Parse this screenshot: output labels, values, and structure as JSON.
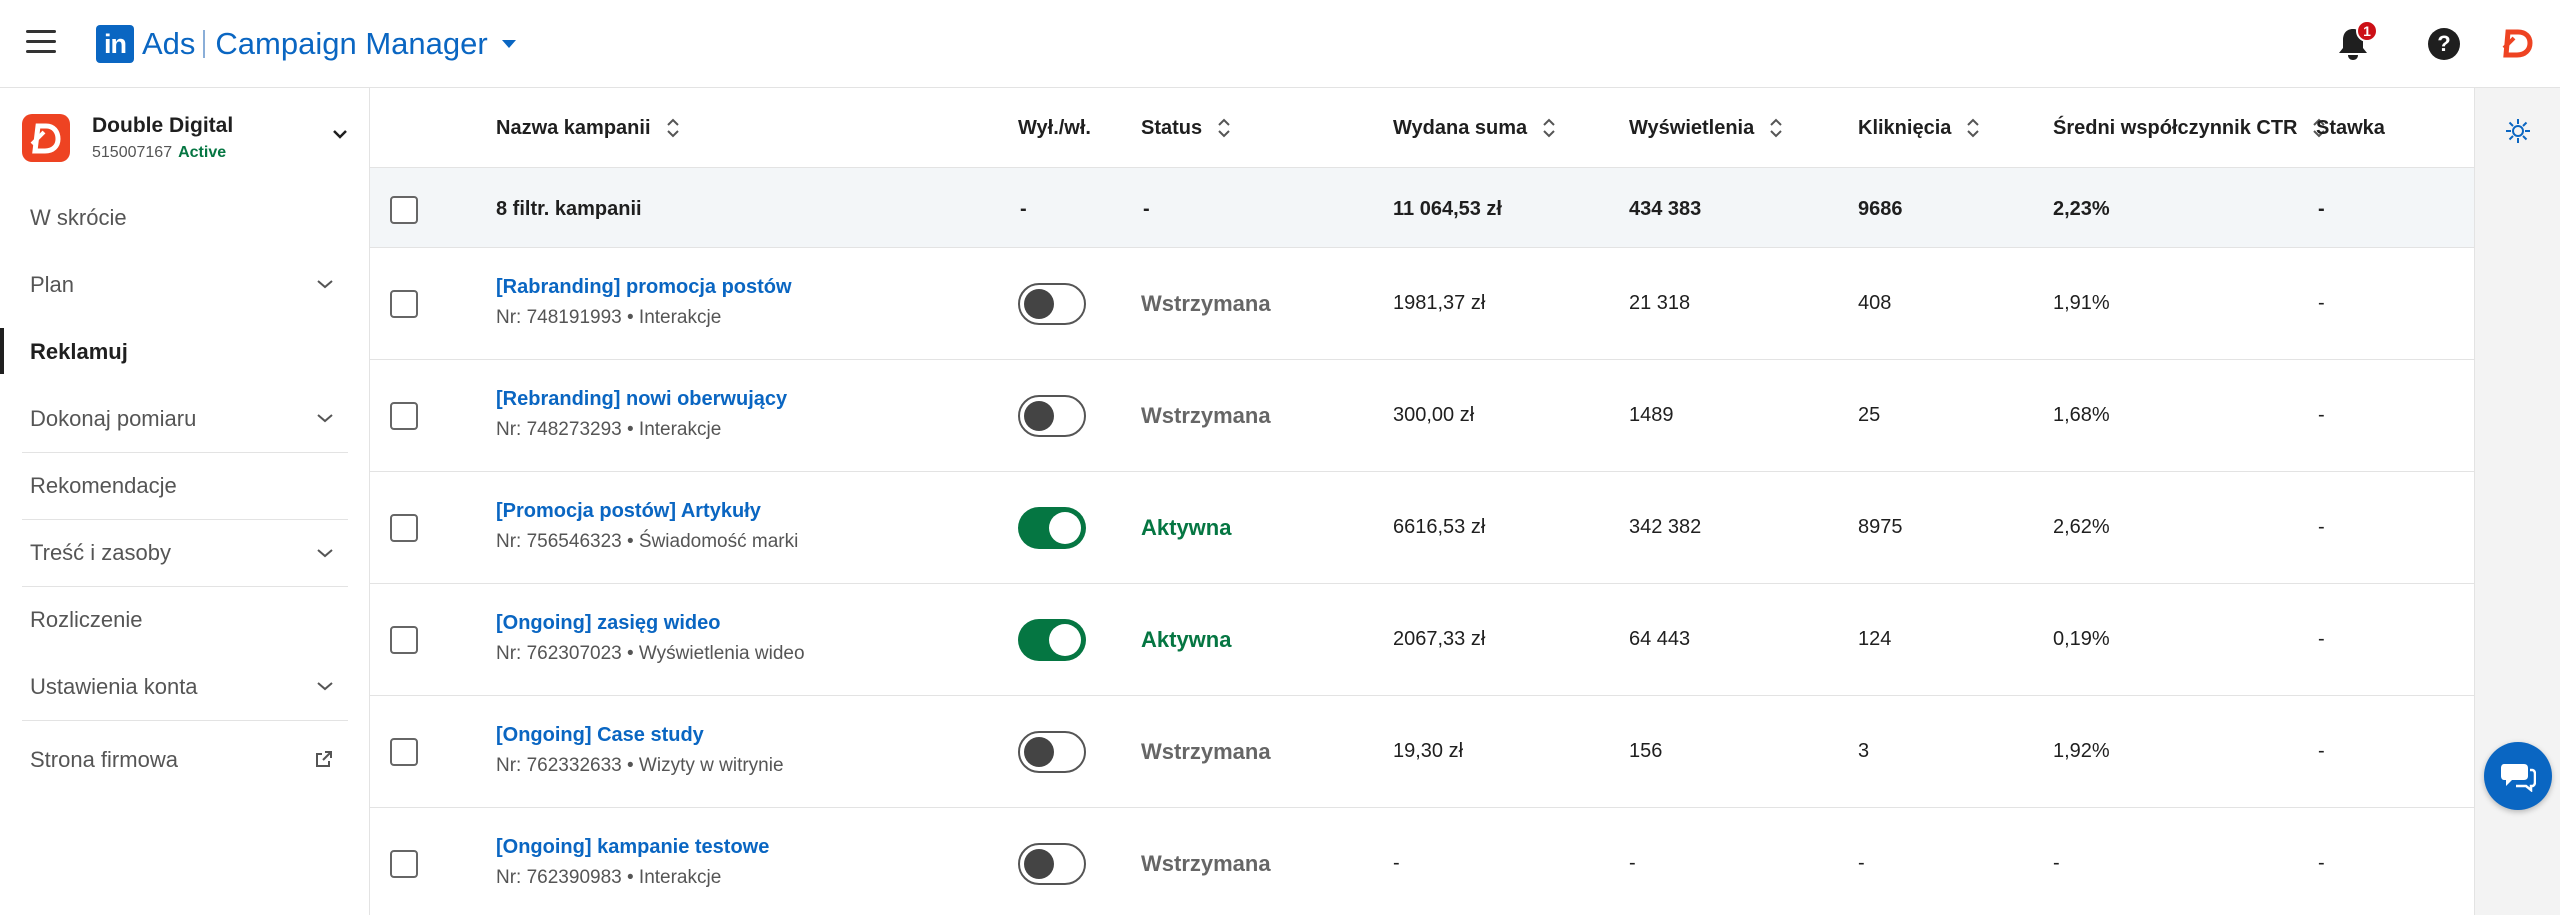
{
  "app": {
    "logo_text": "in",
    "brand_ads": "Ads",
    "brand_product": "Campaign Manager",
    "notification_count": "1",
    "help_symbol": "?"
  },
  "account": {
    "name": "Double Digital",
    "id": "515007167",
    "status": "Active"
  },
  "nav": [
    {
      "label": "W skrócie"
    },
    {
      "label": "Plan"
    },
    {
      "label": "Reklamuj"
    },
    {
      "label": "Dokonaj pomiaru"
    },
    {
      "label": "Rekomendacje"
    },
    {
      "label": "Treść i zasoby"
    },
    {
      "label": "Rozliczenie"
    },
    {
      "label": "Ustawienia konta"
    },
    {
      "label": "Strona firmowa"
    }
  ],
  "table": {
    "headers": {
      "name": "Nazwa kampanii",
      "toggle": "Wył./wł.",
      "status": "Status",
      "spend": "Wydana suma",
      "impressions": "Wyświetlenia",
      "clicks": "Kliknięcia",
      "ctr": "Średni współczynnik CTR",
      "bid": "Stawka"
    },
    "summary": {
      "name": "8 filtr. kampanii",
      "toggle": "-",
      "status": "-",
      "spend": "11 064,53 zł",
      "impressions": "434 383",
      "clicks": "9686",
      "ctr": "2,23%",
      "bid": "-"
    },
    "rows": [
      {
        "name": "[Rabranding] promocja postów",
        "sub": "Nr: 748191993 • Interakcje",
        "status": "Wstrzymana",
        "spend": "1981,37 zł",
        "impressions": "21 318",
        "clicks": "408",
        "ctr": "1,91%",
        "bid": "-"
      },
      {
        "name": "[Rebranding] nowi oberwujący",
        "sub": "Nr: 748273293 • Interakcje",
        "status": "Wstrzymana",
        "spend": "300,00 zł",
        "impressions": "1489",
        "clicks": "25",
        "ctr": "1,68%",
        "bid": "-"
      },
      {
        "name": "[Promocja postów] Artykuły",
        "sub": "Nr: 756546323 • Świadomość marki",
        "status": "Aktywna",
        "spend": "6616,53 zł",
        "impressions": "342 382",
        "clicks": "8975",
        "ctr": "2,62%",
        "bid": "-"
      },
      {
        "name": "[Ongoing] zasięg wideo",
        "sub": "Nr: 762307023 • Wyświetlenia wideo",
        "status": "Aktywna",
        "spend": "2067,33 zł",
        "impressions": "64 443",
        "clicks": "124",
        "ctr": "0,19%",
        "bid": "-"
      },
      {
        "name": "[Ongoing] Case study",
        "sub": "Nr: 762332633 • Wizyty w witrynie",
        "status": "Wstrzymana",
        "spend": "19,30 zł",
        "impressions": "156",
        "clicks": "3",
        "ctr": "1,92%",
        "bid": "-"
      },
      {
        "name": "[Ongoing] kampanie testowe",
        "sub": "Nr: 762390983 • Interakcje",
        "status": "Wstrzymana",
        "spend": "-",
        "impressions": "-",
        "clicks": "-",
        "ctr": "-",
        "bid": "-"
      }
    ]
  },
  "colors": {
    "brand": "#0a66c2",
    "active": "#057642",
    "paused": "#666666",
    "account_logo": "#ee4322"
  },
  "icons": {
    "menu": "hamburger-icon",
    "notifications": "bell-icon",
    "help": "help-icon",
    "user": "user-logo-icon",
    "sort": "sort-icon",
    "chevron": "chevron-down-icon",
    "external": "external-link-icon",
    "rail": "settings-icon",
    "chat": "chat-icon"
  }
}
